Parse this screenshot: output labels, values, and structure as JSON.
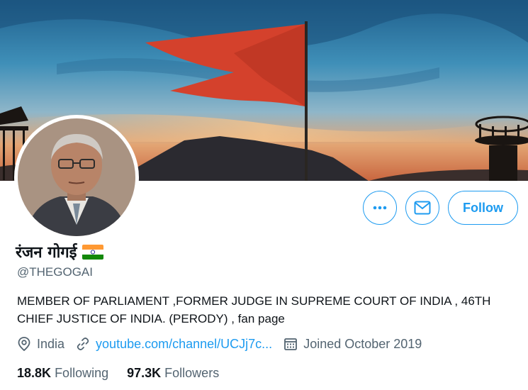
{
  "profile": {
    "display_name": "रंजन गोगई",
    "handle": "@THEGOGAI",
    "bio": "MEMBER OF PARLIAMENT ,FORMER JUDGE IN SUPREME COURT OF INDIA , 46TH CHIEF JUSTICE OF INDIA. (PERODY) , fan page",
    "location": "India",
    "website": "youtube.com/channel/UCJj7c...",
    "joined": "Joined October 2019",
    "flag_icon": "india-flag-icon"
  },
  "stats": {
    "following_count": "18.8K",
    "following_label": "Following",
    "followers_count": "97.3K",
    "followers_label": "Followers"
  },
  "actions": {
    "follow_label": "Follow",
    "more_icon": "ellipsis-icon",
    "message_icon": "envelope-icon"
  },
  "colors": {
    "accent": "#1d9bf0",
    "secondary_text": "#536471",
    "primary_text": "#0f1419"
  }
}
